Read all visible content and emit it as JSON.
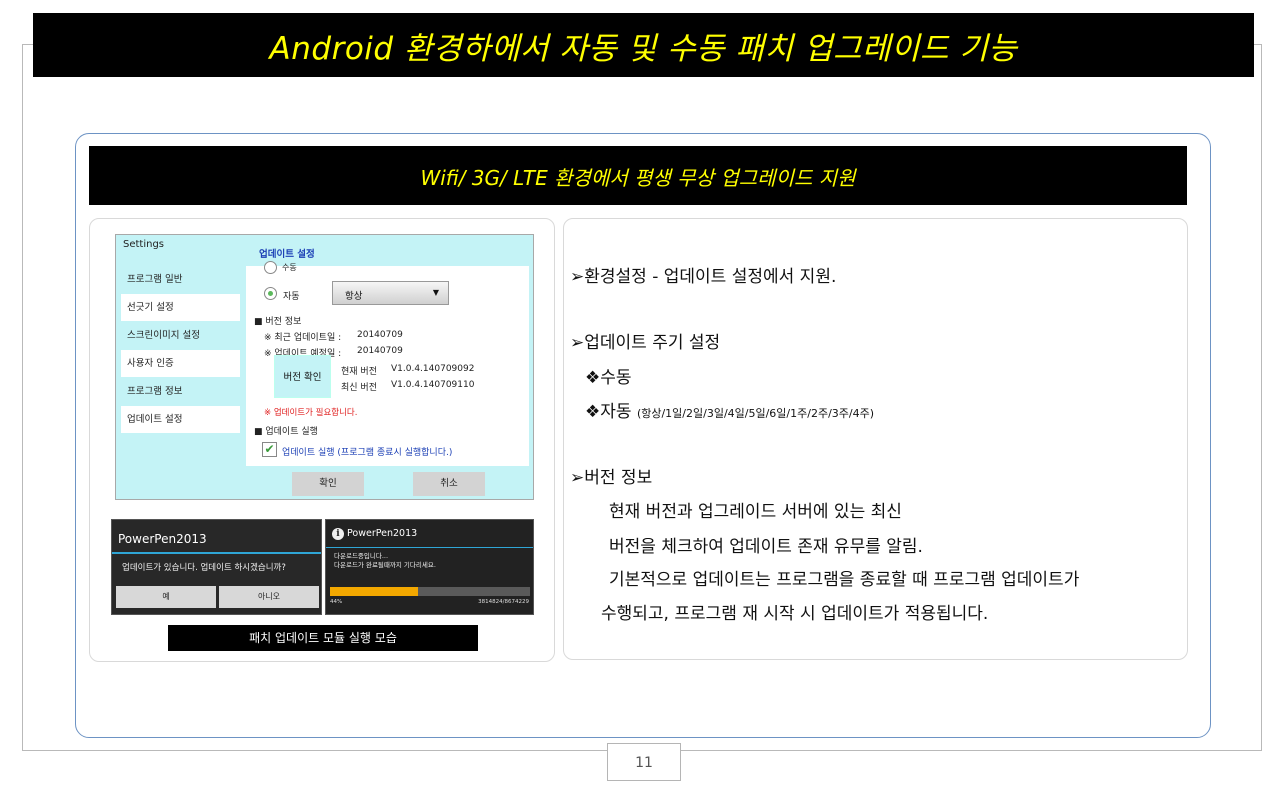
{
  "title": "Android 환경하에서  자동 및 수동 패치 업그레이드 기능",
  "subtitle": "Wifi/ 3G/ LTE 환경에서 평생 무상 업그레이드 지원",
  "settings_shot": {
    "window_title": "Settings",
    "header": "업데이트 설정",
    "sidebar": [
      "프로그램 일반",
      "선긋기 설정",
      "스크린이미지 설정",
      "사용자 인증",
      "프로그램 정보",
      "업데이트 설정"
    ],
    "manual_label": "수동",
    "auto_label": "자동",
    "dropdown_value": "항상",
    "version_info_heading": "■ 버전 정보",
    "last_update_label": "※ 최근 업데이트일 :",
    "last_update_value": "20140709",
    "next_update_label": "※ 업데이트 예정일 :",
    "next_update_value": "20140709",
    "version_check_button": "버전 확인",
    "current_version_label": "현재 버전",
    "current_version_value": "V1.0.4.140709092",
    "latest_version_label": "최신 버전",
    "latest_version_value": "V1.0.4.140709110",
    "update_needed": "※ 업데이트가 필요합니다.",
    "update_run_heading": "■ 업데이트 실행",
    "update_run_checkbox": "업데이트 실행 (프로그램 종료시 실행합니다.)",
    "ok_button": "확인",
    "cancel_button": "취소"
  },
  "dialog1": {
    "title": "PowerPen2013",
    "message": "업데이트가 있습니다. 업데이트 하시겠습니까?",
    "yes_button": "예",
    "no_button": "아니오"
  },
  "dialog2": {
    "title": "PowerPen2013",
    "line1": "다운로드중입니다...",
    "line2": "다운로드가 완료될때까지 기다리세요.",
    "progress_percent": "44%",
    "progress_fraction": 0.44,
    "progress_bytes": "3814824/8674229"
  },
  "caption": "패치 업데이트 모듈 실행 모습",
  "right_panel": {
    "item1": "➢환경설정 - 업데이트 설정에서 지원.",
    "item2": "➢업데이트 주기 설정",
    "item2_manual": "❖수동",
    "item2_auto": "❖자동",
    "item2_auto_detail": "(항상/1일/2일/3일/4일/5일/6일/1주/2주/3주/4주)",
    "item3": "➢버전 정보",
    "item3_line1": "현재 버전과 업그레이드 서버에 있는 최신",
    "item3_line2": "버전을  체크하여 업데이트 존재 유무를 알림.",
    "item3_line3": "기본적으로 업데이트는 프로그램을 종료할 때 프로그램 업데이트가",
    "item3_line4": "수행되고, 프로그램 재 시작 시 업데이트가 적용됩니다."
  },
  "page_number": "11"
}
